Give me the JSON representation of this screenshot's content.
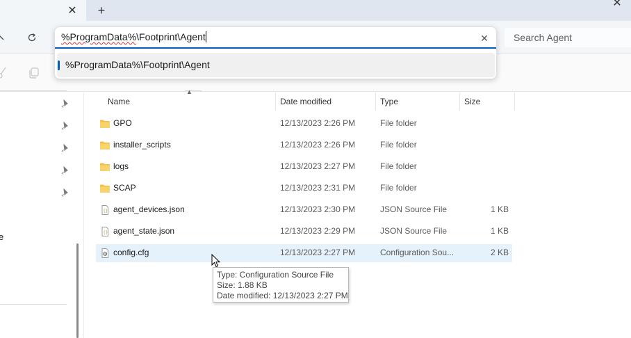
{
  "tabbar": {
    "close_glyph": "✕",
    "add_glyph": "+",
    "window_close_glyph": "✕"
  },
  "navbar": {
    "search": {
      "placeholder": "Search Agent"
    }
  },
  "address": {
    "typed_prefix": "%ProgramData%",
    "typed_rest": "\\Footprint\\Agent",
    "clear_glyph": "✕",
    "suggestion": "%ProgramData%\\Footprint\\Agent"
  },
  "navpane": {
    "partial_item_text": "e"
  },
  "columns": {
    "name": "Name",
    "date": "Date modified",
    "type": "Type",
    "size": "Size"
  },
  "files": [
    {
      "name": "GPO",
      "date": "12/13/2023 2:26 PM",
      "type": "File folder",
      "size": "",
      "icon": "folder-icon"
    },
    {
      "name": "installer_scripts",
      "date": "12/13/2023 2:26 PM",
      "type": "File folder",
      "size": "",
      "icon": "folder-icon"
    },
    {
      "name": "logs",
      "date": "12/13/2023 2:27 PM",
      "type": "File folder",
      "size": "",
      "icon": "folder-icon"
    },
    {
      "name": "SCAP",
      "date": "12/13/2023 2:31 PM",
      "type": "File folder",
      "size": "",
      "icon": "folder-icon"
    },
    {
      "name": "agent_devices.json",
      "date": "12/13/2023 2:30 PM",
      "type": "JSON Source File",
      "size": "1 KB",
      "icon": "json-file-icon"
    },
    {
      "name": "agent_state.json",
      "date": "12/13/2023 2:29 PM",
      "type": "JSON Source File",
      "size": "1 KB",
      "icon": "json-file-icon"
    },
    {
      "name": "config.cfg",
      "date": "12/13/2023 2:27 PM",
      "type": "Configuration Sou...",
      "size": "2 KB",
      "icon": "config-file-icon",
      "selected": true
    }
  ],
  "tooltip": {
    "type_line": "Type: Configuration Source File",
    "size_line": "Size: 1.88 KB",
    "date_line": "Date modified: 12/13/2023 2:27 PM"
  },
  "colors": {
    "accent": "#005fb8",
    "selection": "#e5f1fb",
    "folder": "#f5c342"
  }
}
